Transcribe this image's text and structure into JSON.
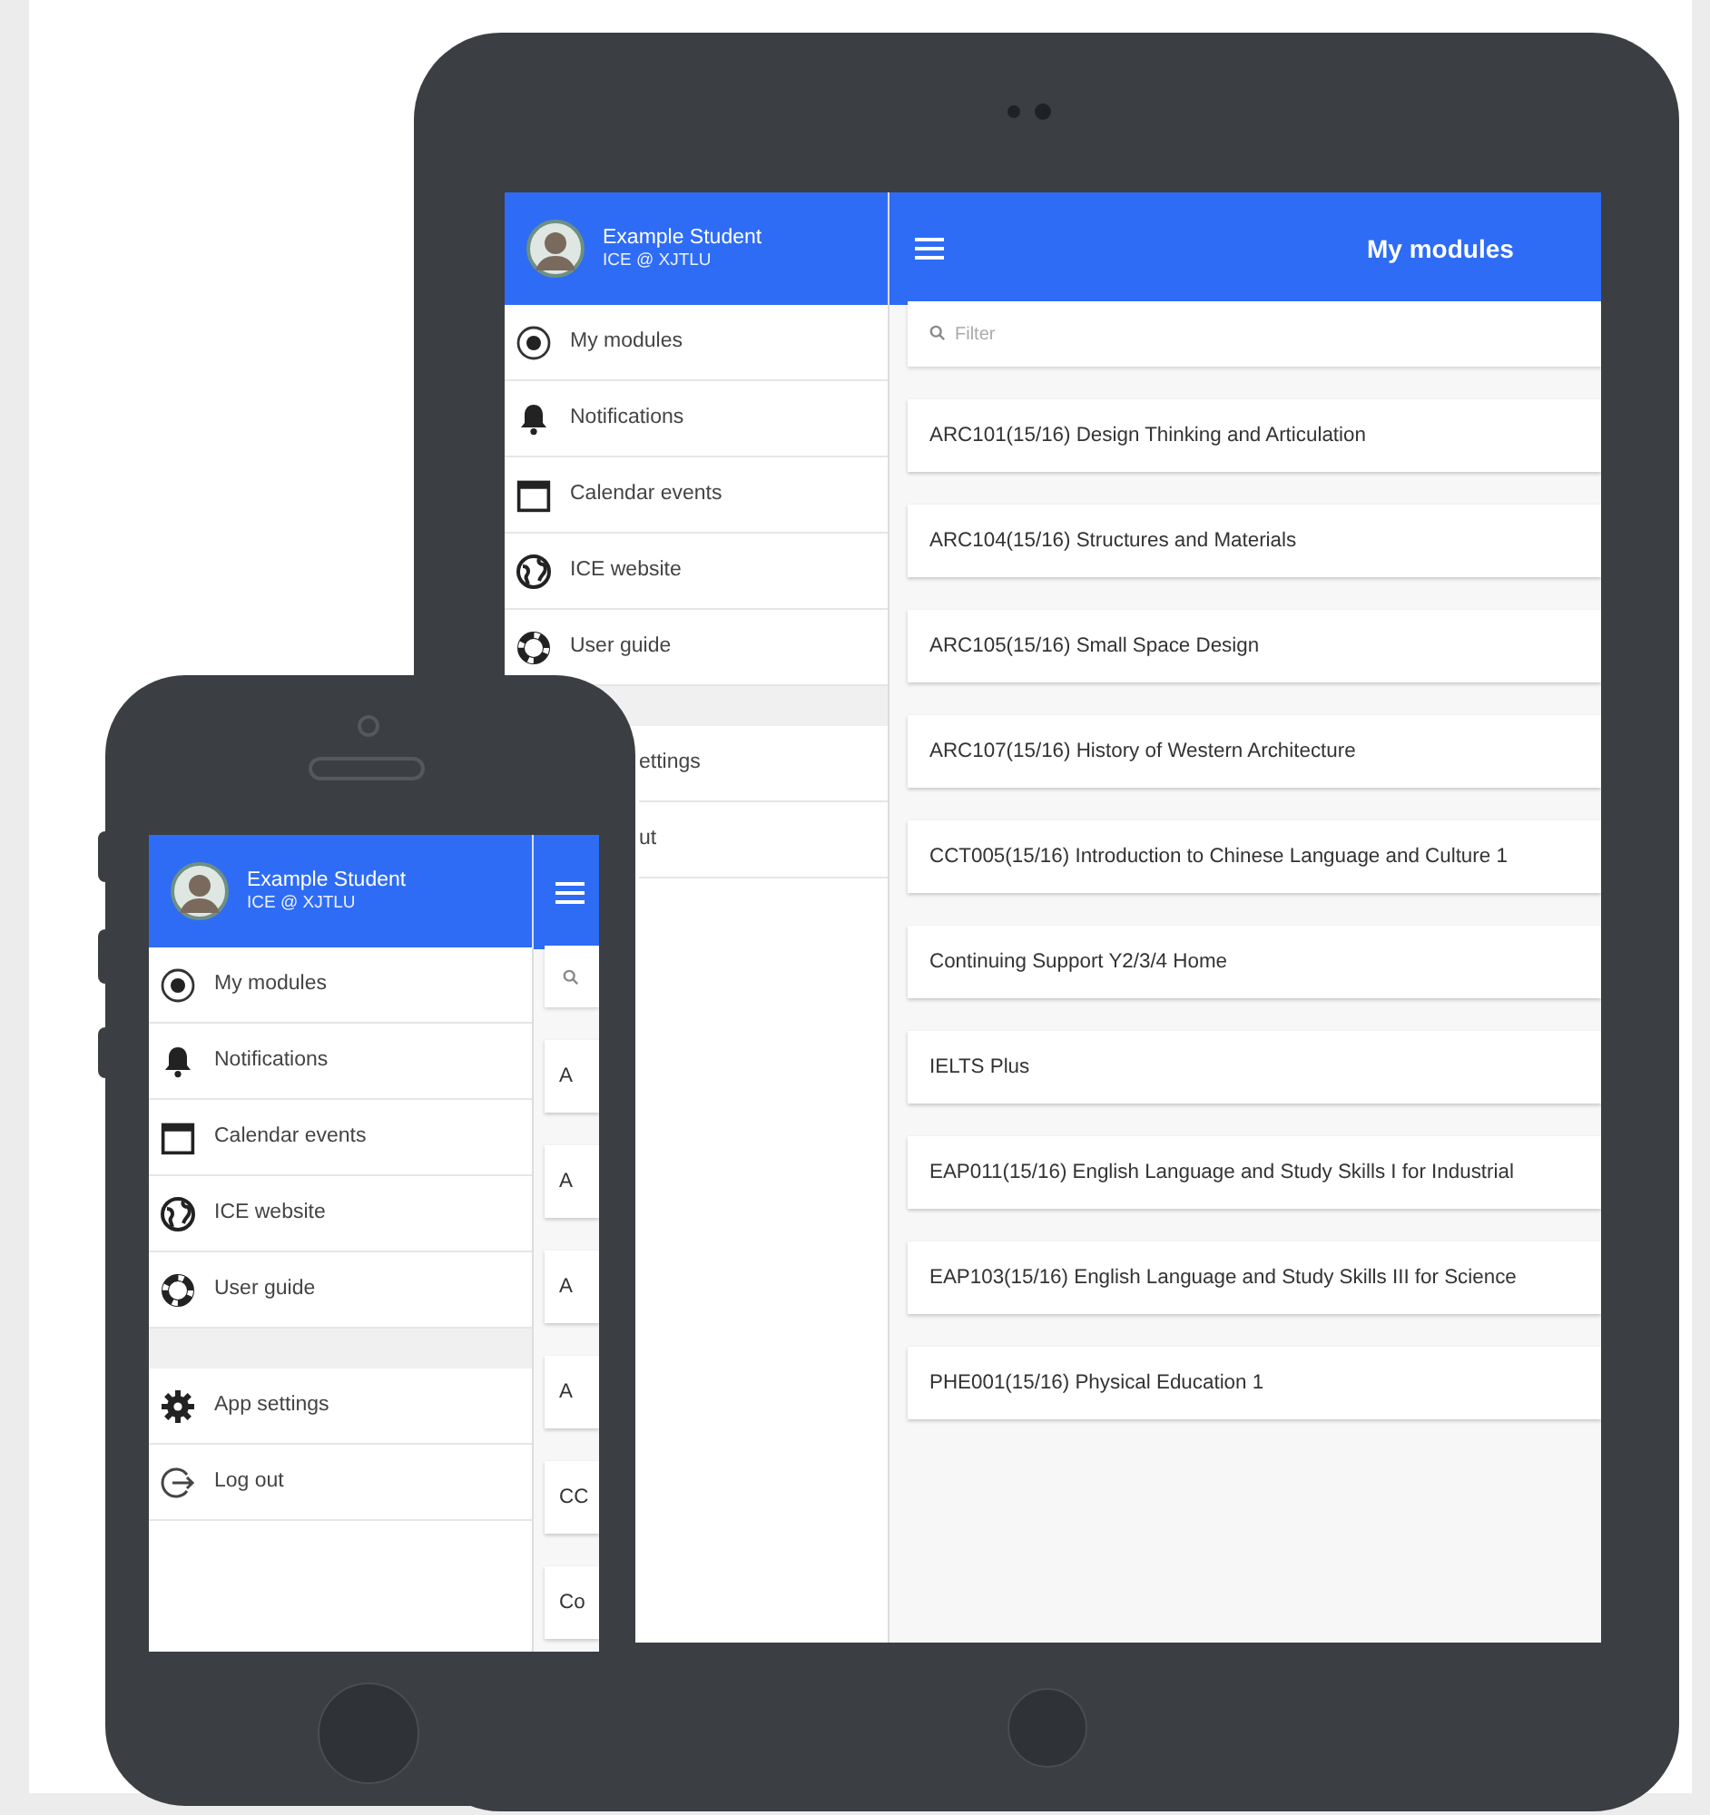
{
  "tablet": {
    "drawer": {
      "user": {
        "name": "Example Student",
        "org": "ICE @ XJTLU"
      },
      "items": [
        {
          "label": "My modules"
        },
        {
          "label": "Notifications"
        },
        {
          "label": "Calendar events"
        },
        {
          "label": "ICE website"
        },
        {
          "label": "User guide"
        }
      ],
      "footer_items": [
        {
          "label": "ettings"
        },
        {
          "label": "ut"
        }
      ]
    },
    "toolbar": {
      "title": "My modules"
    },
    "filter": {
      "placeholder": "Filter"
    },
    "modules": [
      "ARC101(15/16) Design Thinking and Articulation",
      "ARC104(15/16) Structures and Materials",
      "ARC105(15/16) Small Space Design",
      "ARC107(15/16) History of Western Architecture",
      "CCT005(15/16) Introduction to Chinese Language and Culture 1",
      "Continuing Support Y2/3/4 Home",
      "IELTS Plus",
      "EAP011(15/16) English Language and Study Skills I for Industrial",
      "EAP103(15/16) English Language and Study Skills III for Science",
      "PHE001(15/16) Physical Education 1"
    ]
  },
  "phone": {
    "drawer": {
      "user": {
        "name": "Example Student",
        "org": "ICE @ XJTLU"
      },
      "items": [
        {
          "label": "My modules"
        },
        {
          "label": "Notifications"
        },
        {
          "label": "Calendar events"
        },
        {
          "label": "ICE website"
        },
        {
          "label": "User guide"
        }
      ],
      "footer_items": [
        {
          "label": "App settings"
        },
        {
          "label": "Log out"
        }
      ]
    },
    "modules": [
      "A",
      "A",
      "A",
      "A",
      "CC",
      "Co"
    ]
  }
}
